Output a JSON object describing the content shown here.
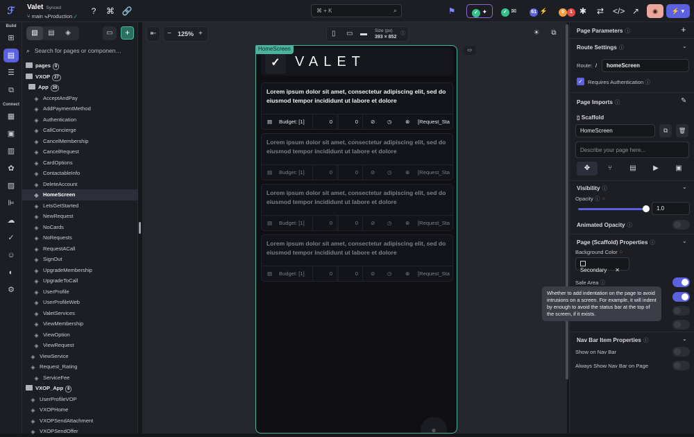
{
  "project": {
    "name": "Valet",
    "synced": "Synced",
    "branch": "main",
    "env": "Production"
  },
  "topbar": {
    "search_placeholder": "⌘ + K",
    "badges": {
      "updates": "61",
      "warnings": "0",
      "errors": "1"
    },
    "colors": {
      "accent": "#5b61e0",
      "ok": "#35c28a",
      "warn": "#f0a040",
      "err": "#e34a4a"
    }
  },
  "rail": {
    "build_label": "Build",
    "connect_label": "Connect"
  },
  "tree": {
    "search_placeholder": "Search for pages or componen…",
    "items": [
      {
        "label": "pages",
        "kind": "folder",
        "count": "0"
      },
      {
        "label": "VXOP",
        "kind": "folder",
        "count": "27"
      },
      {
        "label": "App",
        "kind": "folder",
        "count": "26"
      },
      {
        "label": "AcceptAndPay",
        "kind": "page"
      },
      {
        "label": "AddPaymentMethod",
        "kind": "page"
      },
      {
        "label": "Authentication",
        "kind": "page"
      },
      {
        "label": "CallConcierge",
        "kind": "page"
      },
      {
        "label": "CancelMembership",
        "kind": "page"
      },
      {
        "label": "CancelRequest",
        "kind": "page"
      },
      {
        "label": "CardOptions",
        "kind": "page"
      },
      {
        "label": "ContactableInfo",
        "kind": "page"
      },
      {
        "label": "DeleteAccount",
        "kind": "page"
      },
      {
        "label": "HomeScreen",
        "kind": "page",
        "selected": true
      },
      {
        "label": "LetsGetStarted",
        "kind": "page"
      },
      {
        "label": "NewRequest",
        "kind": "page"
      },
      {
        "label": "NoCards",
        "kind": "page"
      },
      {
        "label": "NoRequests",
        "kind": "page"
      },
      {
        "label": "RequestACall",
        "kind": "page"
      },
      {
        "label": "SignOut",
        "kind": "page"
      },
      {
        "label": "UpgradeMembership",
        "kind": "page"
      },
      {
        "label": "UpgradeToCall",
        "kind": "page"
      },
      {
        "label": "UserProfile",
        "kind": "page"
      },
      {
        "label": "UserProfileWeb",
        "kind": "page"
      },
      {
        "label": "ValetServices",
        "kind": "page"
      },
      {
        "label": "ViewMembership",
        "kind": "page"
      },
      {
        "label": "ViewOption",
        "kind": "page"
      },
      {
        "label": "ViewRequest",
        "kind": "page"
      },
      {
        "label": "ViewService",
        "kind": "page"
      },
      {
        "label": "Request_Rating",
        "kind": "page"
      },
      {
        "label": "ServiceFee",
        "kind": "page"
      },
      {
        "label": "VXOP_App",
        "kind": "folder",
        "count": "6"
      },
      {
        "label": "UserProfileVOP",
        "kind": "page"
      },
      {
        "label": "VXOPHome",
        "kind": "page"
      },
      {
        "label": "VXOPSendAttachment",
        "kind": "page"
      },
      {
        "label": "VXOPSendOffer",
        "kind": "page"
      }
    ]
  },
  "canvas": {
    "zoom": "125%",
    "size_label": "Size (px)",
    "size_value": "393 × 852",
    "screen_name": "HomeScreen",
    "logo_text": "VALET",
    "cards": [
      {
        "text": "Lorem ipsum dolor sit amet, consectetur adipiscing elit, sed do eiusmod tempor incididunt ut labore et dolore",
        "budget": "Budget: [1]",
        "v1": "0",
        "v2": "0",
        "req": "[Request_Sta"
      },
      {
        "text": "Lorem ipsum dolor sit amet, consectetur adipiscing elit, sed do eiusmod tempor incididunt ut labore et dolore",
        "budget": "Budget: [1]",
        "v1": "0",
        "v2": "0",
        "req": "[Request_Sta"
      },
      {
        "text": "Lorem ipsum dolor sit amet, consectetur adipiscing elit, sed do eiusmod tempor incididunt ut labore et dolore",
        "budget": "Budget: [1]",
        "v1": "0",
        "v2": "0",
        "req": "[Request_Sta"
      },
      {
        "text": "Lorem ipsum dolor sit amet, consectetur adipiscing elit, sed do eiusmod tempor incididunt ut labore et dolore",
        "budget": "Budget: [1]",
        "v1": "0",
        "v2": "0",
        "req": "[Request_Sta"
      }
    ]
  },
  "props": {
    "page_parameters": "Page Parameters",
    "route_settings": "Route Settings",
    "route_label": "Route:",
    "route_slash": "/",
    "route_value": "homeScreen",
    "requires_auth": "Requires Authentication",
    "page_imports": "Page Imports",
    "scaffold": "Scaffold",
    "scaffold_name": "HomeScreen",
    "describe_placeholder": "Describe your page here...",
    "visibility": "Visibility",
    "opacity_label": "Opacity",
    "opacity_value": "1.0",
    "opacity_fraction": 1.0,
    "animated_opacity": "Animated Opacity",
    "scaffold_props": "Page (Scaffold) Properties",
    "background_color": "Background Color",
    "bg_value": "Secondary",
    "safe_area": "Safe Area",
    "tooltip": "Whether to add indentation on the page to avoid intrusions on a screen. For example, it will indent by enough to avoid the status bar at the top of the screen, if it exists.",
    "navbar_props": "Nav Bar Item Properties",
    "show_on_nav": "Show on Nav Bar",
    "always_show_nav": "Always Show Nav Bar on Page"
  }
}
